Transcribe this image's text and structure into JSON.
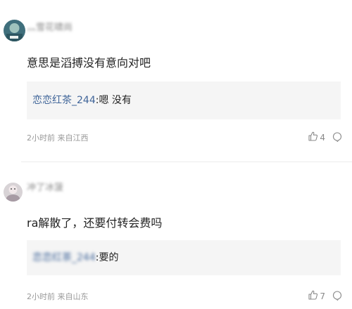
{
  "comments": [
    {
      "username": "灬雪花啸尚",
      "text": "意思是滔搏没有意向对吧",
      "reply": {
        "author": "恋恋红茶_244",
        "sep": ":",
        "text": "嗯 没有"
      },
      "time": "2小时前",
      "location": "来自江西",
      "likes": "4",
      "avatar_color": "#4e7b86"
    },
    {
      "username": "冲了冰菠",
      "text": "ra解散了，还要付转会费吗",
      "reply": {
        "author": "恋恋红茶_244",
        "sep": ":",
        "text": "要的"
      },
      "time": "2小时前",
      "location": "来自山东",
      "likes": "7",
      "avatar_color": "#c9c3c8"
    }
  ],
  "icons": {
    "like": "thumbs-up-icon",
    "reply": "comment-bubble-icon"
  },
  "colors": {
    "reply_author": "#406599",
    "meta": "#999999",
    "reply_bg": "#f5f5f5"
  }
}
